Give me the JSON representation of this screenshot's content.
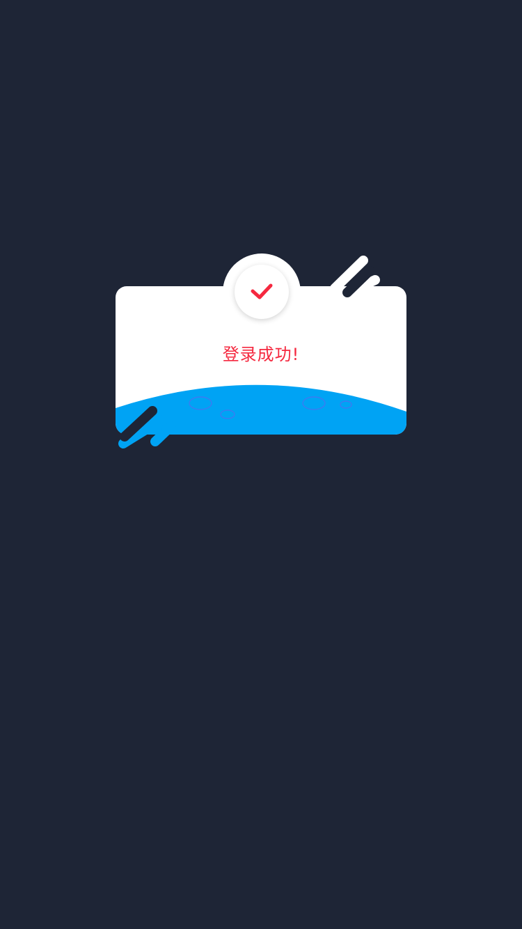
{
  "dialog": {
    "message": "登录成功!",
    "icon": "checkmark-icon"
  },
  "colors": {
    "background": "#1e2536",
    "card": "#ffffff",
    "accent_red": "#f5283f",
    "wave_blue": "#00a3f4",
    "crater_stroke": "#3c7bf2"
  }
}
